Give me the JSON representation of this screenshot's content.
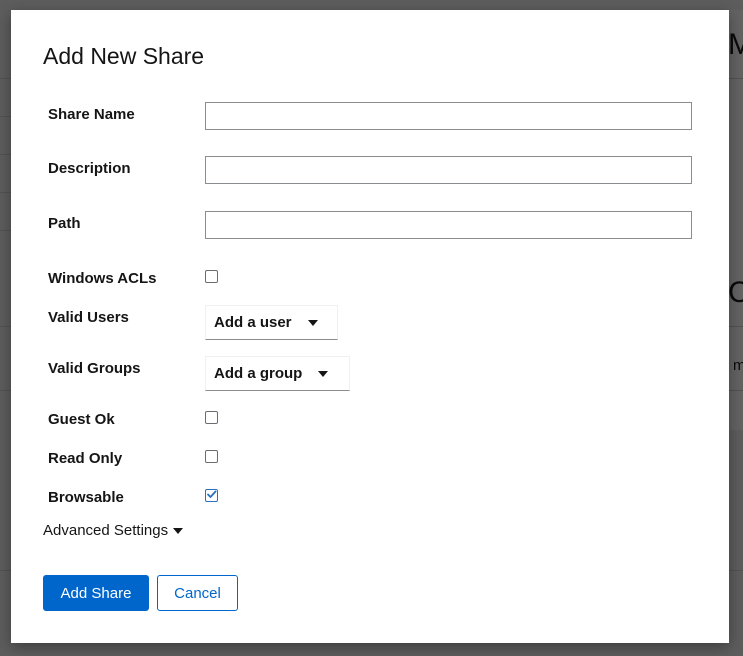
{
  "background": {
    "big_text_1": "M",
    "big_text_2": "C",
    "small_text": "m"
  },
  "modal": {
    "title": "Add New Share",
    "fields": {
      "share_name": {
        "label": "Share Name",
        "value": "",
        "placeholder": ""
      },
      "description": {
        "label": "Description",
        "value": "",
        "placeholder": ""
      },
      "path": {
        "label": "Path",
        "value": "",
        "placeholder": ""
      },
      "windows_acls": {
        "label": "Windows ACLs",
        "checked": false
      },
      "valid_users": {
        "label": "Valid Users",
        "selected": "Add a user"
      },
      "valid_groups": {
        "label": "Valid Groups",
        "selected": "Add a group"
      },
      "guest_ok": {
        "label": "Guest Ok",
        "checked": false
      },
      "read_only": {
        "label": "Read Only",
        "checked": false
      },
      "browsable": {
        "label": "Browsable",
        "checked": true
      }
    },
    "advanced_settings_label": "Advanced Settings",
    "add_button_label": "Add Share",
    "cancel_button_label": "Cancel"
  },
  "colors": {
    "primary": "#0066cc",
    "text": "#151515",
    "input_border": "#8a8d90",
    "checkbox_checked": "#2b6fc2"
  }
}
